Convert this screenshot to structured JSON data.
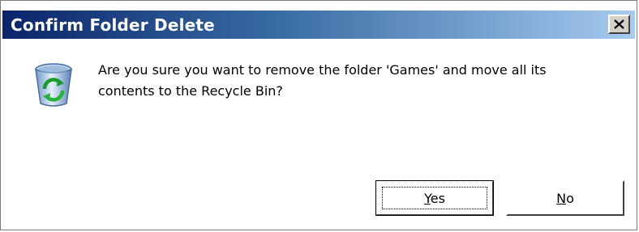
{
  "window": {
    "title": "Confirm Folder Delete",
    "close_label": "×"
  },
  "message": {
    "line1": "Are you sure you want to remove the folder 'Games' and move all its",
    "line2": "contents to the Recycle Bin?"
  },
  "buttons": {
    "yes": {
      "mnemonic": "Y",
      "rest": "es"
    },
    "no": {
      "mnemonic": "N",
      "rest": "o"
    }
  },
  "icons": {
    "dialog_icon": "recycle-bin-icon",
    "close_icon": "close-icon"
  },
  "colors": {
    "titlebar_start": "#0a246a",
    "titlebar_end": "#a6caf0",
    "button_face": "#d4d0c8"
  }
}
